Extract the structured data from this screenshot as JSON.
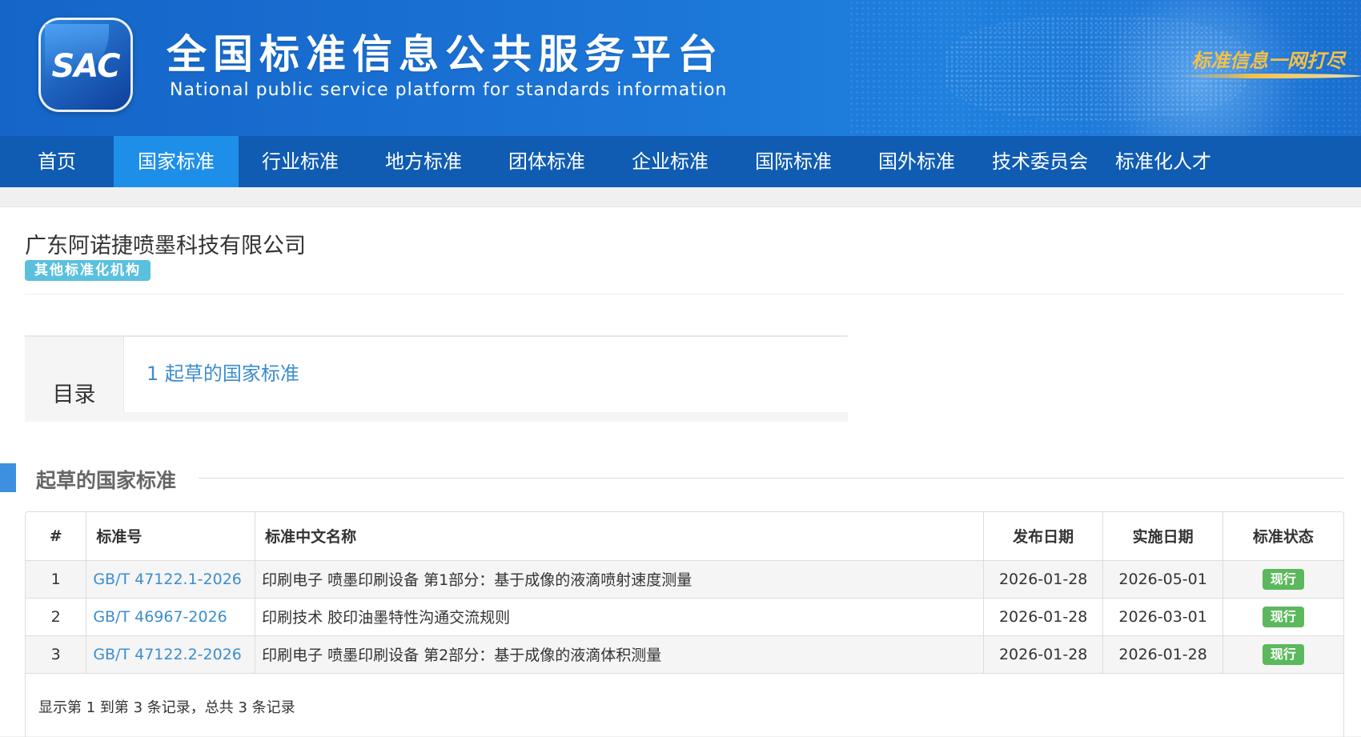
{
  "header": {
    "logo_text": "SAC",
    "title": "全国标准信息公共服务平台",
    "subtitle": "National public service platform  for standards information",
    "slogan": "标准信息一网打尽"
  },
  "nav": {
    "items": [
      {
        "label": "首页",
        "active": false
      },
      {
        "label": "国家标准",
        "active": true
      },
      {
        "label": "行业标准",
        "active": false
      },
      {
        "label": "地方标准",
        "active": false
      },
      {
        "label": "团体标准",
        "active": false
      },
      {
        "label": "企业标准",
        "active": false
      },
      {
        "label": "国际标准",
        "active": false
      },
      {
        "label": "国外标准",
        "active": false
      },
      {
        "label": "技术委员会",
        "active": false
      },
      {
        "label": "标准化人才",
        "active": false
      }
    ]
  },
  "org": {
    "name": "广东阿诺捷喷墨科技有限公司",
    "badge": "其他标准化机构"
  },
  "toc": {
    "label": "目录",
    "link": "1  起草的国家标准"
  },
  "section": {
    "title": "起草的国家标准"
  },
  "table": {
    "headers": [
      "#",
      "标准号",
      "标准中文名称",
      "发布日期",
      "实施日期",
      "标准状态"
    ],
    "rows": [
      {
        "index": "1",
        "code": "GB/T 47122.1-2026",
        "name": "印刷电子 喷墨印刷设备 第1部分：基于成像的液滴喷射速度测量",
        "publish_date": "2026-01-28",
        "effective_date": "2026-05-01",
        "status": "现行"
      },
      {
        "index": "2",
        "code": "GB/T 46967-2026",
        "name": "印刷技术 胶印油墨特性沟通交流规则",
        "publish_date": "2026-01-28",
        "effective_date": "2026-03-01",
        "status": "现行"
      },
      {
        "index": "3",
        "code": "GB/T 47122.2-2026",
        "name": "印刷电子 喷墨印刷设备 第2部分：基于成像的液滴体积测量",
        "publish_date": "2026-01-28",
        "effective_date": "2026-01-28",
        "status": "现行"
      }
    ],
    "pagination_text": "显示第 1 到第 3 条记录，总共 3 条记录"
  },
  "colors": {
    "nav_bg": "#0f5cb2",
    "nav_active": "#1e8fe8",
    "link": "#3c8dcf",
    "badge": "#5bc0de",
    "status_current": "#5cb85c",
    "section_bar": "#3d8fe0"
  }
}
